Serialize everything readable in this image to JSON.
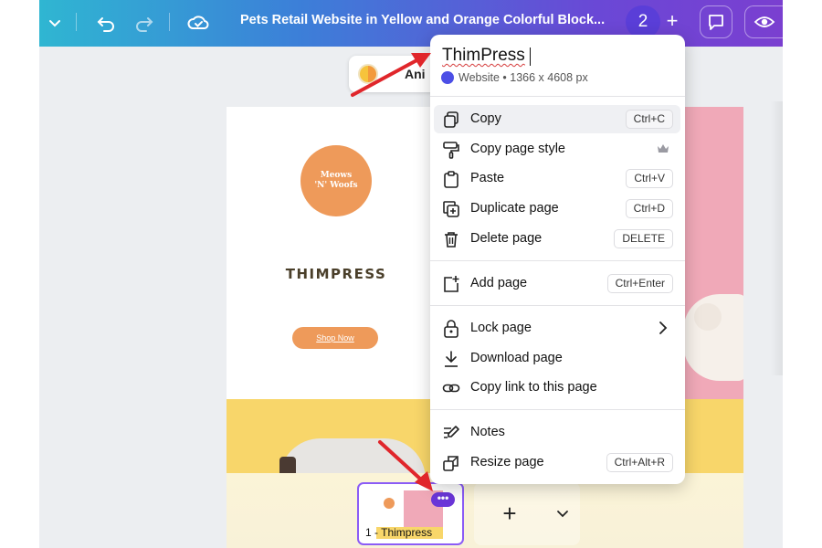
{
  "topbar": {
    "doc_title": "Pets Retail Website in Yellow and Orange Colorful Block...",
    "page_count": "2",
    "add_label": "+",
    "icons": [
      "chevron-down-icon",
      "undo-icon",
      "redo-icon",
      "cloud-saved-icon",
      "add-icon",
      "comment-icon",
      "eye-icon"
    ]
  },
  "toolbar": {
    "animate_label": "Ani"
  },
  "design": {
    "logo_line1": "Meows",
    "logo_line2": "'N' Woofs",
    "brand": "THIMPRESS",
    "shop_button": "Shop Now",
    "colors": {
      "pink": "#f0a9b8",
      "yellow": "#f8d66a",
      "orange": "#ee9a5a"
    }
  },
  "menu": {
    "page_name": "ThimPress",
    "page_type": "Website • 1366 x 4608 px",
    "groups": [
      [
        {
          "label": "Copy",
          "shortcut": "Ctrl+C",
          "icon": "copy-icon"
        },
        {
          "label": "Copy page style",
          "shortcut": "",
          "icon": "paint-roller-icon",
          "badge": "crown-icon"
        },
        {
          "label": "Paste",
          "shortcut": "Ctrl+V",
          "icon": "clipboard-icon"
        },
        {
          "label": "Duplicate page",
          "shortcut": "Ctrl+D",
          "icon": "duplicate-icon"
        },
        {
          "label": "Delete page",
          "shortcut": "DELETE",
          "icon": "trash-icon"
        }
      ],
      [
        {
          "label": "Add page",
          "shortcut": "Ctrl+Enter",
          "icon": "add-page-icon"
        }
      ],
      [
        {
          "label": "Lock page",
          "shortcut": "",
          "icon": "lock-icon",
          "submenu": true
        },
        {
          "label": "Download page",
          "shortcut": "",
          "icon": "download-icon"
        },
        {
          "label": "Copy link to this page",
          "shortcut": "",
          "icon": "link-icon"
        }
      ],
      [
        {
          "label": "Notes",
          "shortcut": "",
          "icon": "notes-icon"
        },
        {
          "label": "Resize page",
          "shortcut": "Ctrl+Alt+R",
          "icon": "resize-icon"
        }
      ]
    ]
  },
  "pages": {
    "thumb_label": "1 - Thimpress",
    "more_label": "•••",
    "add_label": "+"
  }
}
